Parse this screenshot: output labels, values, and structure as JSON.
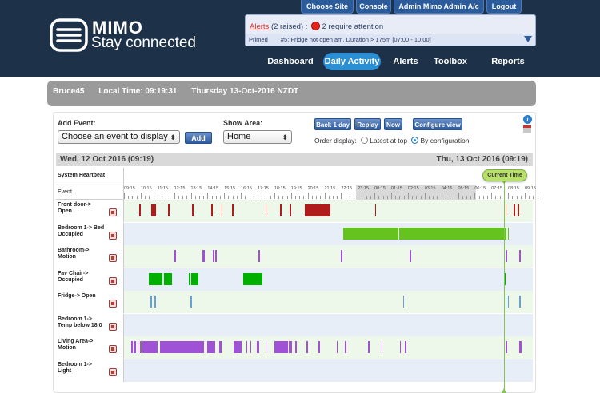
{
  "brand": {
    "name": "MIMO",
    "tagline": "Stay connected"
  },
  "top_nav": [
    {
      "label": "Choose Site"
    },
    {
      "label": "Console"
    },
    {
      "label": "Admin Mimo Admin A/c"
    },
    {
      "label": "Logout"
    }
  ],
  "alert": {
    "link_text": "Alerts",
    "raised_text": "(2 raised) :",
    "attention_text": "2 require attention",
    "status": "Primed",
    "detail": "#5: Fridge not open am.",
    "duration": "Duration > 175m [07:00 - 10:00]"
  },
  "main_nav": [
    {
      "label": "Dashboard",
      "active": false
    },
    {
      "label": "Daily Activity",
      "active": true
    },
    {
      "label": "Alerts",
      "active": false
    },
    {
      "label": "Toolbox",
      "active": false
    },
    {
      "label": "Reports",
      "active": false
    }
  ],
  "info_bar": {
    "user": "Bruce45",
    "local_time": "Local Time: 09:19:31",
    "date": "Thursday 13-Oct-2016 NZDT"
  },
  "controls": {
    "add_event_label": "Add Event:",
    "add_event_value": "Choose an event to display",
    "add_button": "Add",
    "show_area_label": "Show Area:",
    "show_area_value": "Home",
    "back_button": "Back 1 day",
    "replay_button": "Replay",
    "now_button": "Now",
    "configure_button": "Configure view",
    "order_label": "Order display:",
    "order_latest": "Latest at top",
    "order_config": "By configuration",
    "order_selected": "By configuration"
  },
  "timeline": {
    "start_date": "Wed, 12 Oct 2016 (09:19)",
    "end_date": "Thu, 13 Oct 2016 (09:19)",
    "heartbeat_label": "System Heartbeat",
    "event_header": "Event",
    "current_time_label": "Current Time",
    "ticks": [
      "09:15",
      "10:15",
      "11:15",
      "12:15",
      "13:15",
      "14:15",
      "15:15",
      "16:15",
      "17:15",
      "18:15",
      "19:15",
      "20:15",
      "21:15",
      "22:15",
      "23:15",
      "00:15",
      "01:15",
      "02:15",
      "03:15",
      "04:15",
      "05:15",
      "06:15",
      "07:15",
      "08:15",
      "09:15"
    ],
    "colors": {
      "red": "#b01c1c",
      "green": "#66c21e",
      "purple": "#a052d6",
      "blue": "#6aa0d8",
      "green_row": "#eef8ea",
      "blue_row": "#e8eef8"
    },
    "rows": [
      {
        "label": "Front door-> Open",
        "color": "#b01c1c",
        "events": [
          [
            0.9,
            0.1
          ],
          [
            1.65,
            0.3
          ],
          [
            2.65,
            0.08
          ],
          [
            4.1,
            0.05
          ],
          [
            5.25,
            0.05
          ],
          [
            5.85,
            0.05
          ],
          [
            6.5,
            0.1
          ],
          [
            8.5,
            0.08
          ],
          [
            9.4,
            0.03
          ],
          [
            9.95,
            0.1
          ],
          [
            10.9,
            1.5
          ],
          [
            15.1,
            0.05
          ],
          [
            22.95,
            0.08
          ],
          [
            23.45,
            0.05
          ],
          [
            23.7,
            0.08
          ]
        ]
      },
      {
        "label": "Bedroom 1-> Bed Occupied",
        "color": "#66c21e",
        "events": [
          [
            13.2,
            3.3
          ],
          [
            16.55,
            6.4
          ],
          [
            22.95,
            0.08
          ],
          [
            23.1,
            0.05
          ]
        ]
      },
      {
        "label": "Bathroom-> Motion",
        "color": "#a052d6",
        "events": [
          [
            3.05,
            0.05
          ],
          [
            4.7,
            0.15
          ],
          [
            5.35,
            0.05
          ],
          [
            5.5,
            0.05
          ],
          [
            8.1,
            0.05
          ],
          [
            13.05,
            0.1
          ],
          [
            17.2,
            0.05
          ],
          [
            22.95,
            0.12
          ],
          [
            23.8,
            0.1
          ]
        ]
      },
      {
        "label": "Fav Chair-> Occupied",
        "color": "#00b000",
        "events": [
          [
            1.5,
            0.8
          ],
          [
            2.4,
            0.5
          ],
          [
            3.9,
            0.1
          ],
          [
            4.05,
            0.45
          ],
          [
            7.15,
            1.2
          ],
          [
            22.9,
            0.05
          ]
        ]
      },
      {
        "label": "Fridge-> Open",
        "color": "#6aa0d8",
        "events": [
          [
            1.6,
            0.05
          ],
          [
            1.85,
            0.05
          ],
          [
            4.0,
            0.05
          ],
          [
            16.8,
            0.05
          ],
          [
            22.95,
            0.05
          ],
          [
            23.1,
            0.05
          ],
          [
            23.8,
            0.05
          ]
        ]
      },
      {
        "label": "Bedroom 1-> Temp below 18.0",
        "color": "#6aa0d8",
        "events": []
      },
      {
        "label": "Living Area-> Motion",
        "color": "#a052d6",
        "events": [
          [
            0.45,
            0.05
          ],
          [
            0.6,
            0.1
          ],
          [
            0.8,
            0.05
          ],
          [
            0.95,
            0.1
          ],
          [
            1.1,
            0.9
          ],
          [
            2.15,
            2.6
          ],
          [
            3.7,
            0.05
          ],
          [
            3.95,
            0.1
          ],
          [
            4.3,
            0.1
          ],
          [
            4.65,
            0.15
          ],
          [
            5.0,
            0.5
          ],
          [
            5.75,
            0.1
          ],
          [
            6.6,
            0.5
          ],
          [
            7.35,
            0.08
          ],
          [
            7.6,
            0.05
          ],
          [
            8.0,
            0.15
          ],
          [
            8.5,
            0.05
          ],
          [
            9.05,
            0.8
          ],
          [
            9.9,
            0.2
          ],
          [
            10.3,
            0.1
          ],
          [
            11.0,
            0.05
          ],
          [
            11.7,
            0.1
          ],
          [
            12.8,
            0.05
          ],
          [
            13.3,
            0.05
          ],
          [
            14.7,
            0.1
          ],
          [
            15.5,
            0.05
          ],
          [
            16.6,
            0.05
          ],
          [
            16.9,
            0.1
          ],
          [
            22.95,
            0.1
          ],
          [
            23.8,
            0.15
          ]
        ]
      },
      {
        "label": "Bedroom 1-> Light",
        "color": "#d4a020",
        "events": []
      }
    ]
  }
}
